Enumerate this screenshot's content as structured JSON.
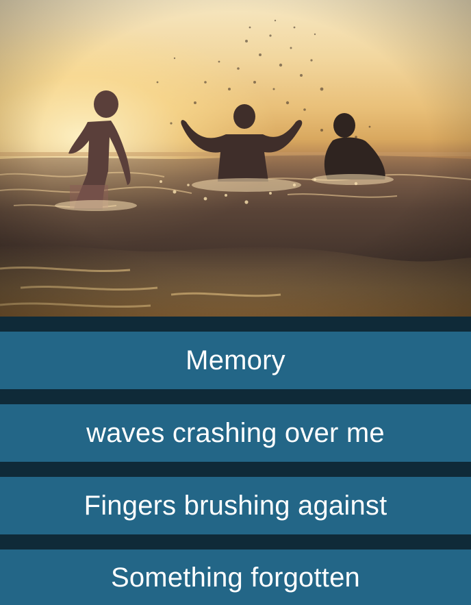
{
  "hero": {
    "image": "kids-splashing-in-sea-at-sunset"
  },
  "poem": {
    "lines": [
      "Memory",
      "waves crashing over me",
      "Fingers brushing against",
      "Something forgotten"
    ]
  },
  "colors": {
    "background": "#0f2a38",
    "row_fill": "#236687",
    "text": "#ffffff"
  }
}
